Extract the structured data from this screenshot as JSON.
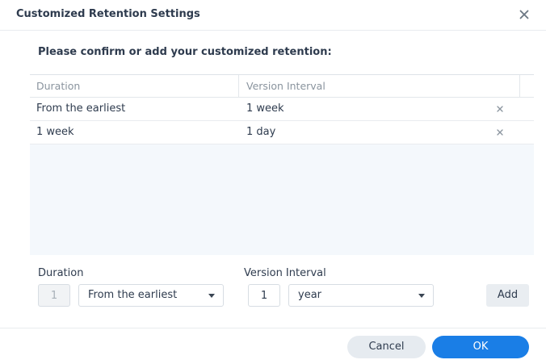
{
  "dialog": {
    "title": "Customized Retention Settings",
    "prompt": "Please confirm or add your customized retention:"
  },
  "table": {
    "columns": [
      "Duration",
      "Version Interval"
    ],
    "rows": [
      {
        "duration": "From the earliest",
        "interval": "1 week"
      },
      {
        "duration": "1 week",
        "interval": "1 day"
      }
    ]
  },
  "form": {
    "duration_label": "Duration",
    "duration_number": "1",
    "duration_select": "From the earliest",
    "interval_label": "Version Interval",
    "interval_number": "1",
    "interval_select": "year",
    "add_label": "Add"
  },
  "footer": {
    "cancel_label": "Cancel",
    "ok_label": "OK"
  },
  "colors": {
    "primary": "#1a7ee6",
    "grid_background": "#f4f8fc"
  }
}
